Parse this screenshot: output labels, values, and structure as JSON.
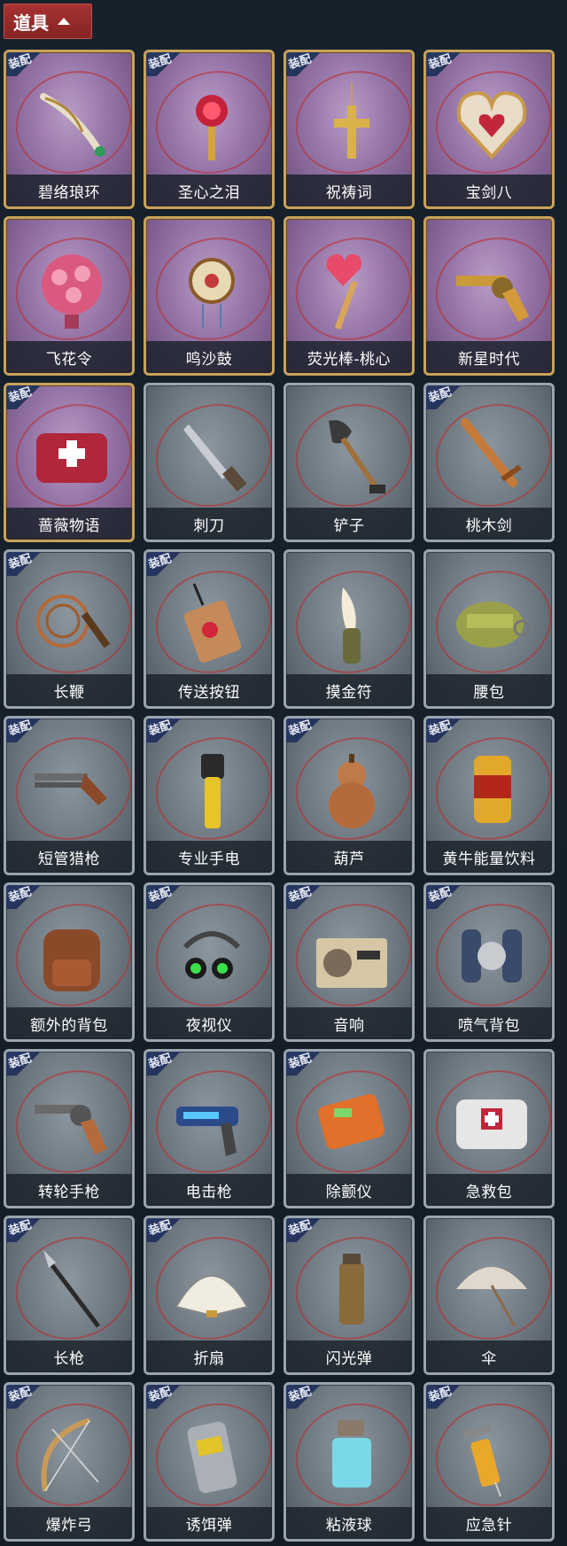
{
  "header": {
    "label": "道具",
    "icon": "chevron-up-icon"
  },
  "items": [
    {
      "name": "碧络琅环",
      "equipped": true,
      "tier": "rare",
      "icon": "jade-blade-icon"
    },
    {
      "name": "圣心之泪",
      "equipped": true,
      "tier": "rare",
      "icon": "ruby-scepter-icon"
    },
    {
      "name": "祝祷词",
      "equipped": true,
      "tier": "rare",
      "icon": "gold-cross-icon"
    },
    {
      "name": "宝剑八",
      "equipped": true,
      "tier": "rare",
      "icon": "heart-locket-icon"
    },
    {
      "name": "飞花令",
      "equipped": false,
      "tier": "rare",
      "icon": "flower-lantern-icon"
    },
    {
      "name": "鸣沙鼓",
      "equipped": false,
      "tier": "rare",
      "icon": "drum-amulet-icon"
    },
    {
      "name": "荧光棒-桃心",
      "equipped": false,
      "tier": "rare",
      "icon": "heart-wand-icon"
    },
    {
      "name": "新星时代",
      "equipped": false,
      "tier": "rare",
      "icon": "golden-revolver-icon"
    },
    {
      "name": "蔷薇物语",
      "equipped": true,
      "tier": "rare",
      "icon": "medkit-case-icon"
    },
    {
      "name": "刺刀",
      "equipped": false,
      "tier": "common",
      "icon": "knife-icon"
    },
    {
      "name": "铲子",
      "equipped": false,
      "tier": "common",
      "icon": "shovel-icon"
    },
    {
      "name": "桃木剑",
      "equipped": true,
      "tier": "common",
      "icon": "wooden-sword-icon"
    },
    {
      "name": "长鞭",
      "equipped": true,
      "tier": "common",
      "icon": "whip-icon"
    },
    {
      "name": "传送按钮",
      "equipped": true,
      "tier": "common",
      "icon": "remote-button-icon"
    },
    {
      "name": "摸金符",
      "equipped": false,
      "tier": "common",
      "icon": "tooth-charm-icon"
    },
    {
      "name": "腰包",
      "equipped": false,
      "tier": "common",
      "icon": "waist-bag-icon"
    },
    {
      "name": "短管猎枪",
      "equipped": true,
      "tier": "common",
      "icon": "shotgun-icon"
    },
    {
      "name": "专业手电",
      "equipped": true,
      "tier": "common",
      "icon": "flashlight-icon"
    },
    {
      "name": "葫芦",
      "equipped": true,
      "tier": "common",
      "icon": "gourd-icon"
    },
    {
      "name": "黄牛能量饮料",
      "equipped": true,
      "tier": "common",
      "icon": "energy-can-icon"
    },
    {
      "name": "额外的背包",
      "equipped": true,
      "tier": "common",
      "icon": "backpack-icon"
    },
    {
      "name": "夜视仪",
      "equipped": true,
      "tier": "common",
      "icon": "night-goggles-icon"
    },
    {
      "name": "音响",
      "equipped": true,
      "tier": "common",
      "icon": "radio-icon"
    },
    {
      "name": "喷气背包",
      "equipped": true,
      "tier": "common",
      "icon": "jetpack-icon"
    },
    {
      "name": "转轮手枪",
      "equipped": true,
      "tier": "common",
      "icon": "revolver-icon"
    },
    {
      "name": "电击枪",
      "equipped": true,
      "tier": "common",
      "icon": "shock-gun-icon"
    },
    {
      "name": "除颤仪",
      "equipped": true,
      "tier": "common",
      "icon": "defibrillator-icon"
    },
    {
      "name": "急救包",
      "equipped": false,
      "tier": "common",
      "icon": "first-aid-kit-icon"
    },
    {
      "name": "长枪",
      "equipped": true,
      "tier": "common",
      "icon": "spear-icon"
    },
    {
      "name": "折扇",
      "equipped": true,
      "tier": "common",
      "icon": "folding-fan-icon"
    },
    {
      "name": "闪光弹",
      "equipped": true,
      "tier": "common",
      "icon": "flashbang-icon"
    },
    {
      "name": "伞",
      "equipped": false,
      "tier": "common",
      "icon": "umbrella-icon"
    },
    {
      "name": "爆炸弓",
      "equipped": true,
      "tier": "common",
      "icon": "bow-icon"
    },
    {
      "name": "诱饵弹",
      "equipped": true,
      "tier": "common",
      "icon": "decoy-canister-icon"
    },
    {
      "name": "粘液球",
      "equipped": true,
      "tier": "common",
      "icon": "slime-jar-icon"
    },
    {
      "name": "应急针",
      "equipped": true,
      "tier": "common",
      "icon": "syringe-icon"
    }
  ],
  "equip_tag_label": "装配"
}
